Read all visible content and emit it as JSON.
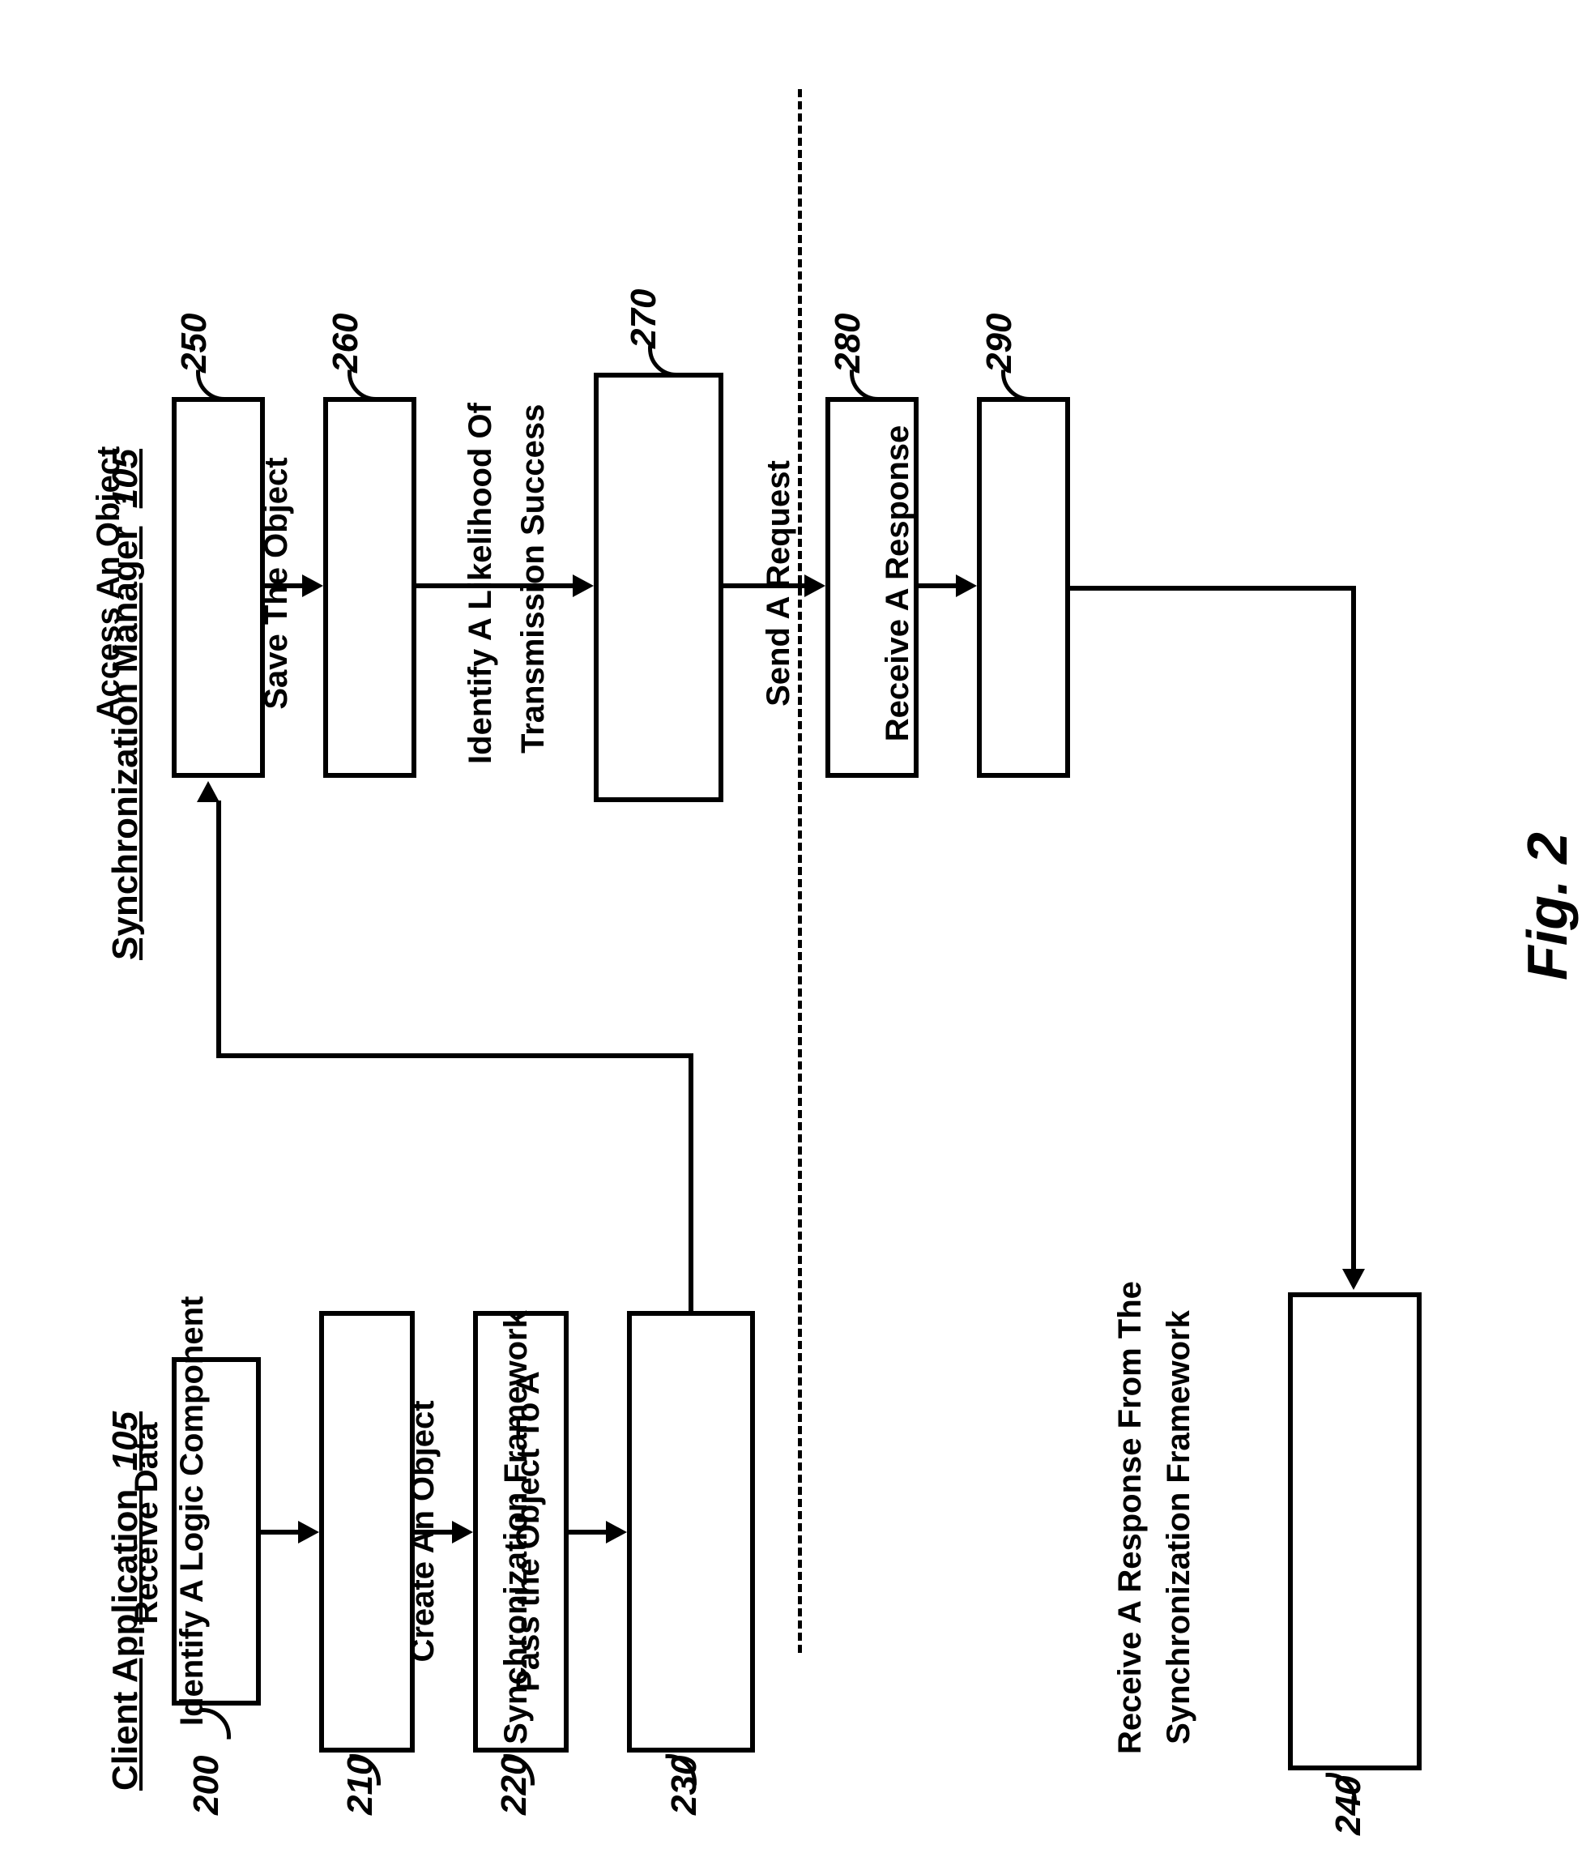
{
  "headings": {
    "client": {
      "label": "Client Application",
      "num": "105"
    },
    "sync": {
      "label": "Synchronization Manager",
      "num": "105"
    }
  },
  "client_boxes": {
    "b200": {
      "text": "Receive Data",
      "num": "200"
    },
    "b210": {
      "text": "Identify A Logic Component",
      "num": "210"
    },
    "b220": {
      "text": "Create An Object",
      "num": "220"
    },
    "b230": {
      "line1": "Pass the Object To A",
      "line2": "Synchronization Framework",
      "num": "230"
    },
    "b240": {
      "line1": "Receive A Response From The",
      "line2": "Synchronization Framework",
      "num": "240"
    }
  },
  "sync_boxes": {
    "b250": {
      "text": "Access An Object",
      "num": "250"
    },
    "b260": {
      "text": "Save The Object",
      "num": "260"
    },
    "b270": {
      "line1": "Identify A Likelihood Of",
      "line2": "Transmission Success",
      "num": "270"
    },
    "b280": {
      "text": "Send A Request",
      "num": "280"
    },
    "b290": {
      "text": "Receive A Response",
      "num": "290"
    }
  },
  "figure_caption": "Fig. 2",
  "chart_data": {
    "type": "flowchart",
    "orientation": "rotated-90-ccw",
    "swimlanes": [
      {
        "id": "client",
        "title": "Client Application 105"
      },
      {
        "id": "sync",
        "title": "Synchronization Manager 105"
      }
    ],
    "nodes": [
      {
        "id": "200",
        "lane": "client",
        "label": "Receive Data"
      },
      {
        "id": "210",
        "lane": "client",
        "label": "Identify A Logic Component"
      },
      {
        "id": "220",
        "lane": "client",
        "label": "Create An Object"
      },
      {
        "id": "230",
        "lane": "client",
        "label": "Pass the Object To A Synchronization Framework"
      },
      {
        "id": "240",
        "lane": "client",
        "label": "Receive A Response From The Synchronization Framework"
      },
      {
        "id": "250",
        "lane": "sync",
        "label": "Access An Object"
      },
      {
        "id": "260",
        "lane": "sync",
        "label": "Save The Object"
      },
      {
        "id": "270",
        "lane": "sync",
        "label": "Identify A Likelihood Of Transmission Success"
      },
      {
        "id": "280",
        "lane": "sync",
        "label": "Send A Request"
      },
      {
        "id": "290",
        "lane": "sync",
        "label": "Receive A Response"
      }
    ],
    "edges": [
      {
        "from": "200",
        "to": "210"
      },
      {
        "from": "210",
        "to": "220"
      },
      {
        "from": "220",
        "to": "230"
      },
      {
        "from": "230",
        "to": "250"
      },
      {
        "from": "250",
        "to": "260"
      },
      {
        "from": "260",
        "to": "270"
      },
      {
        "from": "270",
        "to": "280"
      },
      {
        "from": "280",
        "to": "290"
      },
      {
        "from": "290",
        "to": "240"
      }
    ],
    "figure_label": "Fig. 2"
  }
}
